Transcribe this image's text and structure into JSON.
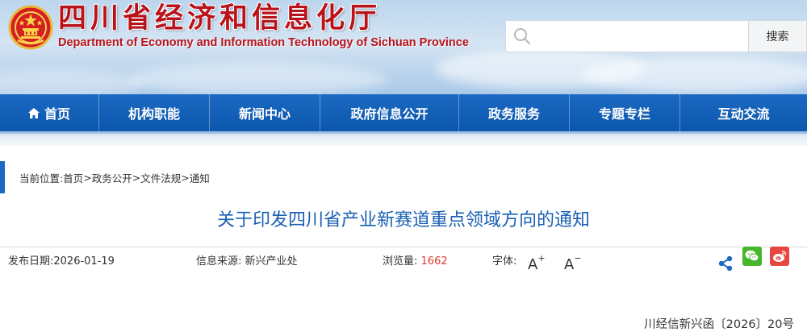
{
  "header": {
    "title": "四川省经济和信息化厅",
    "subtitle": "Department of Economy and Information Technology of Sichuan Province",
    "emblem_icon": "national-emblem-icon"
  },
  "search": {
    "placeholder": "",
    "value": "",
    "button_label": "搜索"
  },
  "nav": {
    "items": [
      {
        "label": "首页",
        "icon": "home-icon"
      },
      {
        "label": "机构职能"
      },
      {
        "label": "新闻中心"
      },
      {
        "label": "政府信息公开"
      },
      {
        "label": "政务服务"
      },
      {
        "label": "专题专栏"
      },
      {
        "label": "互动交流"
      }
    ]
  },
  "breadcrumb": {
    "prefix": "当前位置:",
    "items": [
      "首页",
      "政务公开",
      "文件法规",
      "通知"
    ],
    "separator": ">"
  },
  "article": {
    "title": "关于印发四川省产业新赛道重点领域方向的通知",
    "doc_number": "川经信新兴函〔2026〕20号"
  },
  "meta": {
    "date_label": "发布日期:",
    "date": "2026-01-19",
    "source_label": "信息来源:",
    "source": "新兴产业处",
    "views_label": "浏览量:",
    "views": "1662",
    "font_label": "字体:",
    "font_increase": "A",
    "font_increase_sign": "+",
    "font_decrease": "A",
    "font_decrease_sign": "−"
  },
  "colors": {
    "nav_blue": "#0b57ad",
    "title_blue": "#1a5fb4",
    "brand_red": "#b8131b",
    "views_red": "#e33c2e",
    "wechat_green": "#46b62b",
    "weibo_red": "#e8473f"
  }
}
